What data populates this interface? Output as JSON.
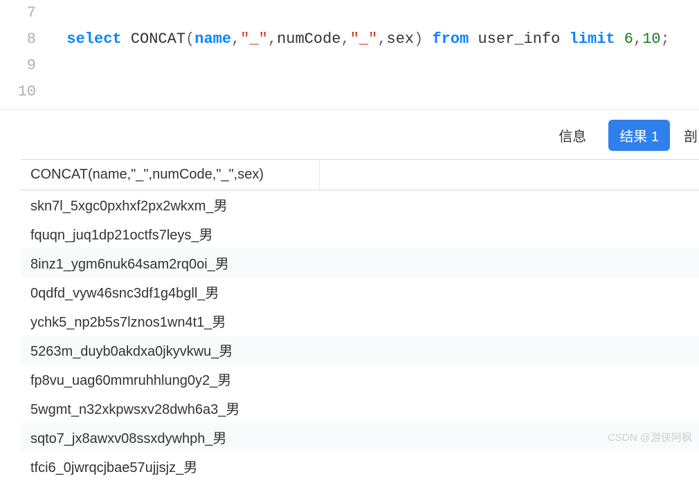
{
  "editor": {
    "lines": [
      {
        "num": "7",
        "tokens": []
      },
      {
        "num": "8",
        "tokens": [
          {
            "t": "  ",
            "c": ""
          },
          {
            "t": "select",
            "c": "kw"
          },
          {
            "t": " ",
            "c": ""
          },
          {
            "t": "CONCAT",
            "c": "fn"
          },
          {
            "t": "(",
            "c": "punct"
          },
          {
            "t": "name",
            "c": "id"
          },
          {
            "t": ",",
            "c": "punct"
          },
          {
            "t": "\"_\"",
            "c": "str"
          },
          {
            "t": ",",
            "c": "punct"
          },
          {
            "t": "numCode",
            "c": "fn"
          },
          {
            "t": ",",
            "c": "punct"
          },
          {
            "t": "\"_\"",
            "c": "str"
          },
          {
            "t": ",",
            "c": "punct"
          },
          {
            "t": "sex",
            "c": "fn"
          },
          {
            "t": ")",
            "c": "punct"
          },
          {
            "t": " ",
            "c": ""
          },
          {
            "t": "from",
            "c": "kw"
          },
          {
            "t": " ",
            "c": ""
          },
          {
            "t": "user_info",
            "c": "fn"
          },
          {
            "t": " ",
            "c": ""
          },
          {
            "t": "limit",
            "c": "kw"
          },
          {
            "t": " ",
            "c": ""
          },
          {
            "t": "6",
            "c": "num"
          },
          {
            "t": ",",
            "c": "punct"
          },
          {
            "t": "10",
            "c": "num"
          },
          {
            "t": ";",
            "c": "punct"
          }
        ]
      },
      {
        "num": "9",
        "tokens": []
      },
      {
        "num": "10",
        "tokens": []
      }
    ]
  },
  "tabs": {
    "info": "信息",
    "result": "结果 1",
    "cut": "剖"
  },
  "result": {
    "header": "CONCAT(name,\"_\",numCode,\"_\",sex)",
    "rows": [
      "skn7l_5xgc0pxhxf2px2wkxm_男",
      "fquqn_juq1dp21octfs7leys_男",
      "8inz1_ygm6nuk64sam2rq0oi_男",
      "0qdfd_vyw46snc3df1g4bgll_男",
      "ychk5_np2b5s7lznos1wn4t1_男",
      "5263m_duyb0akdxa0jkyvkwu_男",
      "fp8vu_uag60mmruhhlung0y2_男",
      "5wgmt_n32xkpwsxv28dwh6a3_男",
      "sqto7_jx8awxv08ssxdywhph_男",
      "tfci6_0jwrqcjbae57ujjsjz_男"
    ],
    "alt_indices": [
      2,
      5,
      8
    ]
  },
  "watermark": "CSDN @游侠阿枫"
}
